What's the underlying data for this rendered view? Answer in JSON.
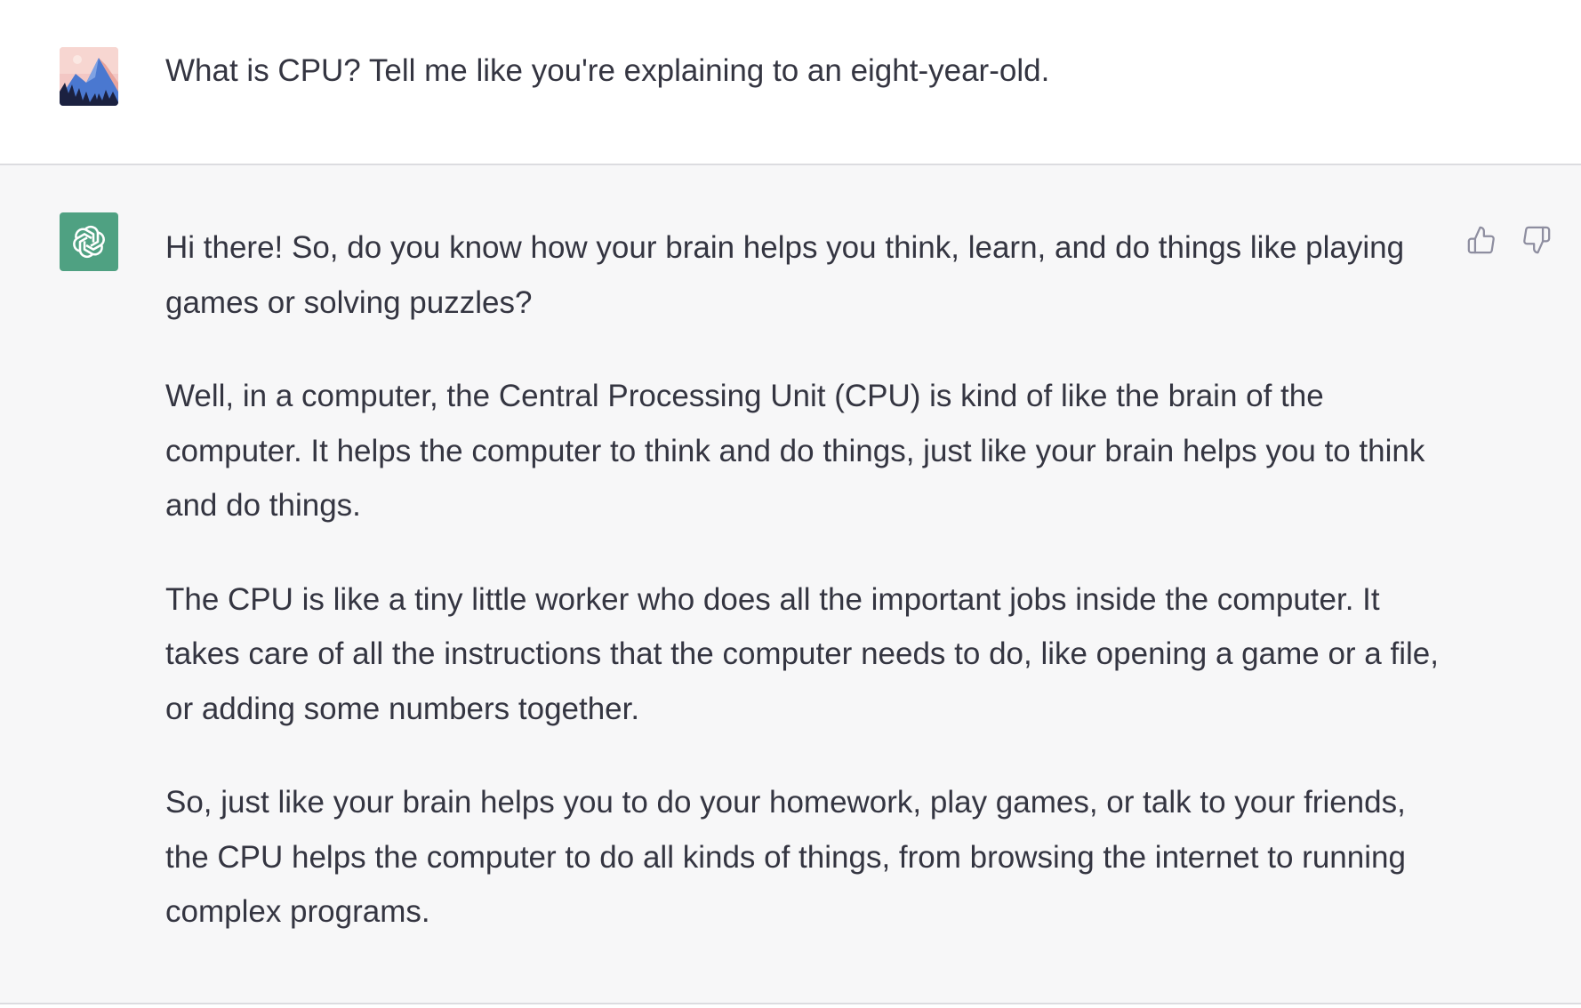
{
  "conversation": {
    "user_message": {
      "text": "What is CPU? Tell me like you're explaining to an eight-year-old."
    },
    "assistant_message": {
      "paragraphs": [
        "Hi there! So, do you know how your brain helps you think, learn, and do things like playing games or solving puzzles?",
        "Well, in a computer, the Central Processing Unit (CPU) is kind of like the brain of the computer. It helps the computer to think and do things, just like your brain helps you to think and do things.",
        "The CPU is like a tiny little worker who does all the important jobs inside the computer. It takes care of all the instructions that the computer needs to do, like opening a game or a file, or adding some numbers together.",
        "So, just like your brain helps you to do your homework, play games, or talk to your friends, the CPU helps the computer to do all kinds of things, from browsing the internet to running complex programs."
      ]
    }
  },
  "icons": {
    "user_avatar": "user-avatar-mountain",
    "assistant_avatar": "openai-logo-icon",
    "like": "thumbs-up-icon",
    "dislike": "thumbs-down-icon"
  },
  "colors": {
    "assistant_avatar_bg": "#4fa182",
    "assistant_row_bg": "#f7f7f8",
    "text": "#343541",
    "icon_gray": "#8e8ea0"
  }
}
